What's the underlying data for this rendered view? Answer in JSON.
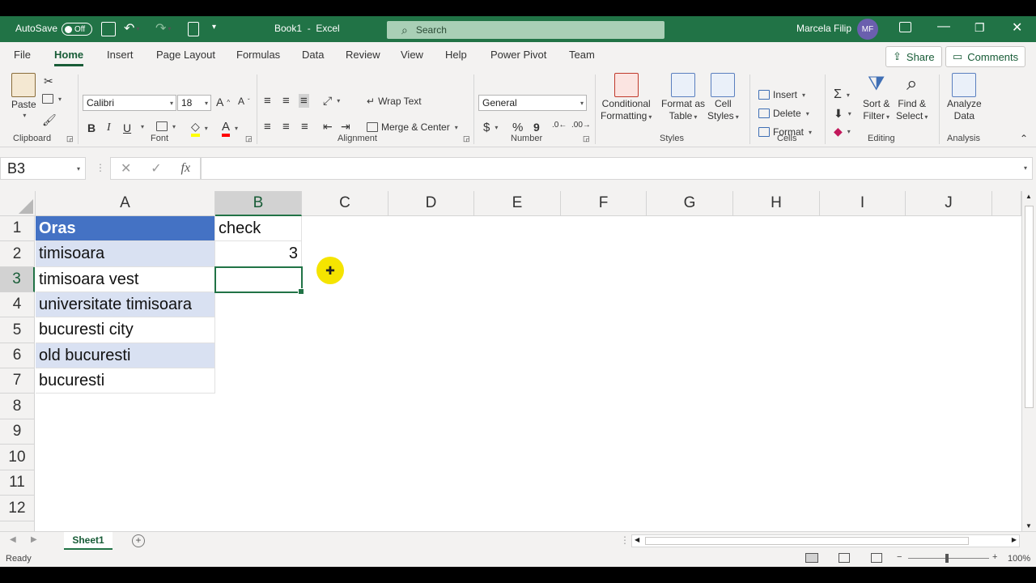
{
  "title_bar": {
    "autosave_label": "AutoSave",
    "autosave_state": "Off",
    "doc_title": "Book1  -  Excel",
    "search_placeholder": "Search",
    "user_name": "Marcela Filip",
    "user_initials": "MF",
    "accent_color": "#217346"
  },
  "menu": {
    "tabs": [
      "File",
      "Home",
      "Insert",
      "Page Layout",
      "Formulas",
      "Data",
      "Review",
      "View",
      "Help",
      "Power Pivot",
      "Team"
    ],
    "active_tab": "Home",
    "share_label": "Share",
    "comments_label": "Comments"
  },
  "ribbon": {
    "clipboard": {
      "paste": "Paste",
      "label": "Clipboard"
    },
    "font": {
      "name": "Calibri",
      "size": "18",
      "bold": "B",
      "italic": "I",
      "underline": "U",
      "label": "Font"
    },
    "alignment": {
      "wrap_text": "Wrap Text",
      "merge_center": "Merge & Center",
      "label": "Alignment"
    },
    "number": {
      "format": "General",
      "currency": "$",
      "percent": "%",
      "comma": "9",
      "label": "Number"
    },
    "styles": {
      "conditional": "Conditional",
      "formatting": "Formatting",
      "format_as": "Format as",
      "table": "Table",
      "cell": "Cell",
      "cell_styles": "Styles",
      "label": "Styles"
    },
    "cells": {
      "insert": "Insert",
      "delete": "Delete",
      "format": "Format",
      "label": "Cells"
    },
    "editing": {
      "sort": "Sort &",
      "filter": "Filter",
      "find": "Find &",
      "select": "Select",
      "label": "Editing"
    },
    "analysis": {
      "analyze": "Analyze",
      "data": "Data",
      "label": "Analysis"
    }
  },
  "formula_bar": {
    "name_box": "B3",
    "fx": "fx",
    "formula": ""
  },
  "sheet": {
    "columns": [
      "A",
      "B",
      "C",
      "D",
      "E",
      "F",
      "G",
      "H",
      "I",
      "J"
    ],
    "selected_column": "B",
    "rows": [
      "1",
      "2",
      "3",
      "4",
      "5",
      "6",
      "7",
      "8",
      "9",
      "10",
      "11",
      "12"
    ],
    "selected_row": "3",
    "cells": {
      "A1": "Oras",
      "A2": "timisoara",
      "A3": "timisoara vest",
      "A4": "universitate timisoara",
      "A5": "bucuresti city",
      "A6": "old bucuresti",
      "A7": "bucuresti",
      "B1": "check",
      "B2": "3"
    },
    "header_fill_color": "#4472c4",
    "band_fill_color": "#d9e1f2",
    "active_cell": "B3"
  },
  "sheet_tabs": {
    "tabs": [
      "Sheet1"
    ],
    "active": "Sheet1"
  },
  "status_bar": {
    "status": "Ready",
    "zoom": "100%"
  }
}
